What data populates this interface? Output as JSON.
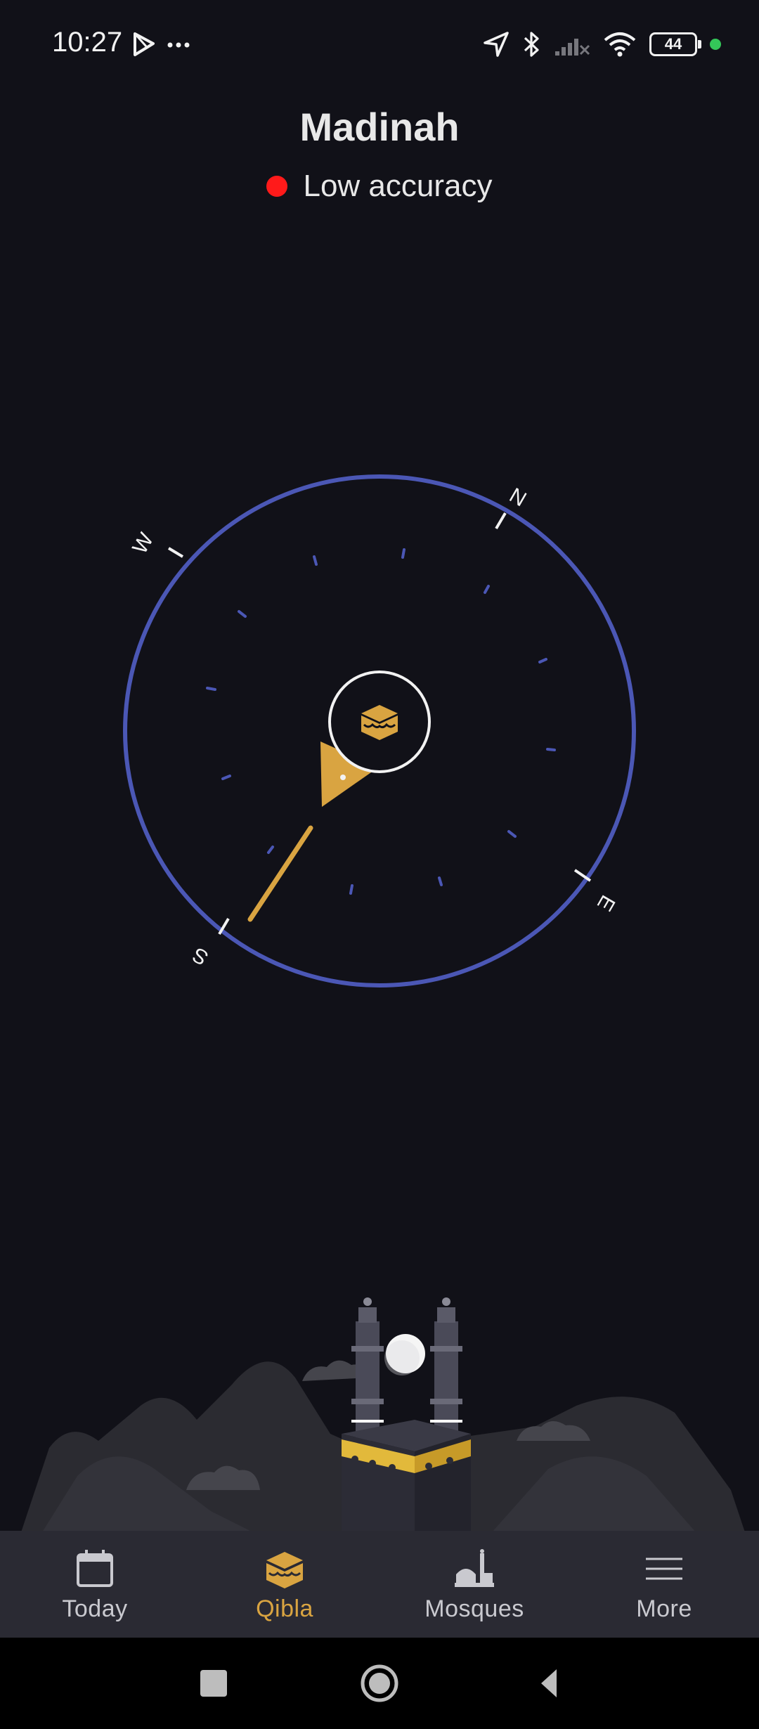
{
  "status_bar": {
    "time": "10:27",
    "icons": [
      "play-store-icon",
      "more-dots-icon",
      "location-arrow-icon",
      "bluetooth-icon",
      "signal-off-icon",
      "wifi-icon"
    ],
    "battery": "44"
  },
  "header": {
    "title": "Madinah",
    "accuracy_label": "Low accuracy",
    "accuracy_color": "#ff1a1a"
  },
  "compass": {
    "directions": {
      "north": "N",
      "east": "E",
      "south": "S",
      "west": "W"
    },
    "ring_color": "#4b57b5",
    "needle_color": "#d9a441",
    "center_icon": "kaaba-icon"
  },
  "bottom_nav": {
    "items": [
      {
        "label": "Today",
        "icon": "calendar-icon",
        "active": false
      },
      {
        "label": "Qibla",
        "icon": "kaaba-icon",
        "active": true
      },
      {
        "label": "Mosques",
        "icon": "mosque-icon",
        "active": false
      },
      {
        "label": "More",
        "icon": "menu-icon",
        "active": false
      }
    ],
    "active_color": "#d9a441"
  },
  "system_nav": {
    "buttons": [
      "recents-button",
      "home-button",
      "back-button"
    ]
  }
}
